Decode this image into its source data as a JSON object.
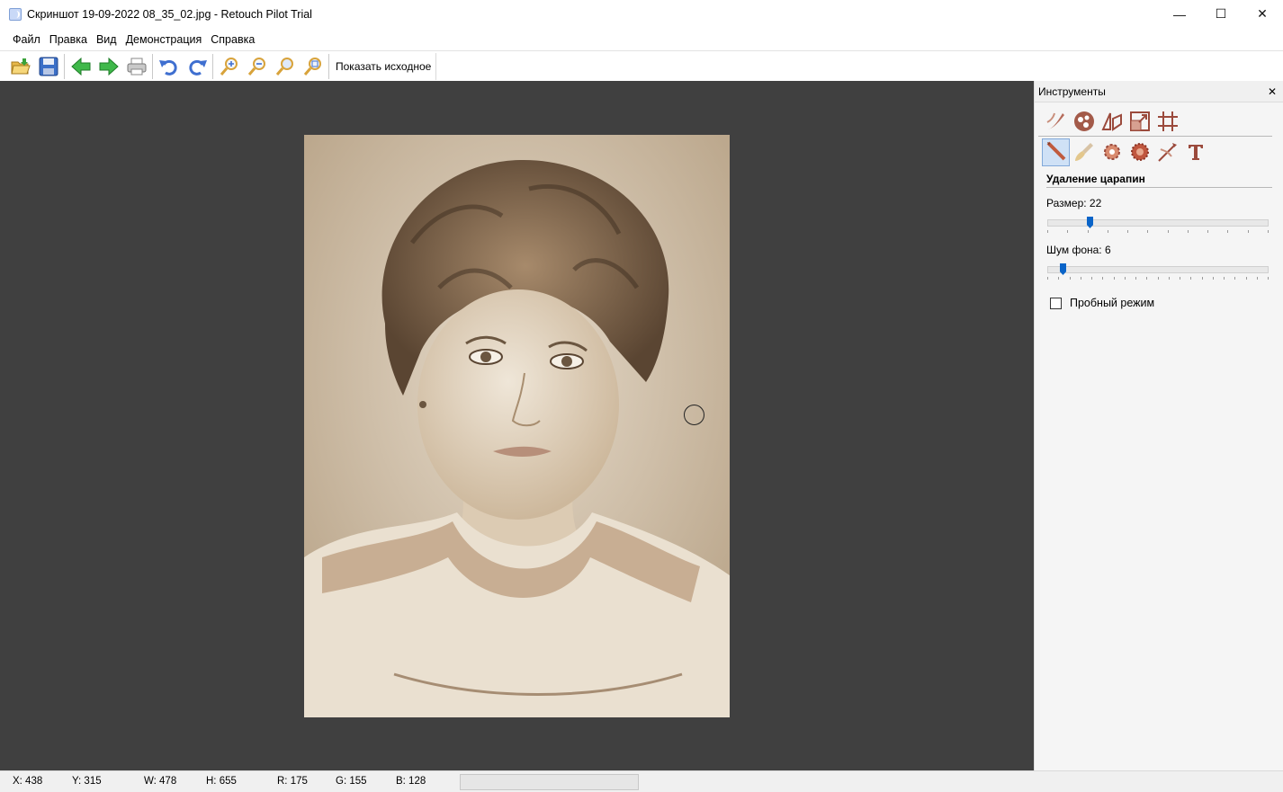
{
  "window": {
    "title": "Скриншот 19-09-2022 08_35_02.jpg - Retouch Pilot Trial",
    "minimize": "—",
    "maximize": "☐",
    "close": "✕"
  },
  "menu": [
    "Файл",
    "Правка",
    "Вид",
    "Демонстрация",
    "Справка"
  ],
  "toolbar": {
    "icons": [
      "open-folder-icon",
      "save-icon",
      "back-arrow-icon",
      "forward-arrow-icon",
      "print-icon",
      "undo-icon",
      "redo-icon",
      "zoom-in-icon",
      "zoom-out-icon",
      "zoom-fit-icon",
      "zoom-actual-icon"
    ],
    "show_original": "Показать исходное"
  },
  "panel": {
    "title": "Инструменты",
    "close": "✕",
    "category_icons": [
      "retouch-brush-icon",
      "color-wheel-icon",
      "perspective-icon",
      "resize-icon",
      "crop-grid-icon"
    ],
    "tool_icons": [
      "scratch-removal-icon",
      "brush-icon",
      "defect-fix-icon",
      "stamp-icon",
      "smudge-icon",
      "text-icon"
    ],
    "active_tool": "Удаление царапин",
    "size_label": "Размер: 22",
    "size_value": 22,
    "noise_label": "Шум фона: 6",
    "noise_value": 6,
    "trial_mode": "Пробный режим",
    "trial_checked": false
  },
  "status": {
    "x": "X: 438",
    "y": "Y: 315",
    "w": "W: 478",
    "h": "H: 655",
    "r": "R: 175",
    "g": "G: 155",
    "b": "B: 128"
  },
  "colors": {
    "canvas_bg": "#404040",
    "accent": "#0a64c8",
    "icon_brown": "#9b4a3c"
  }
}
